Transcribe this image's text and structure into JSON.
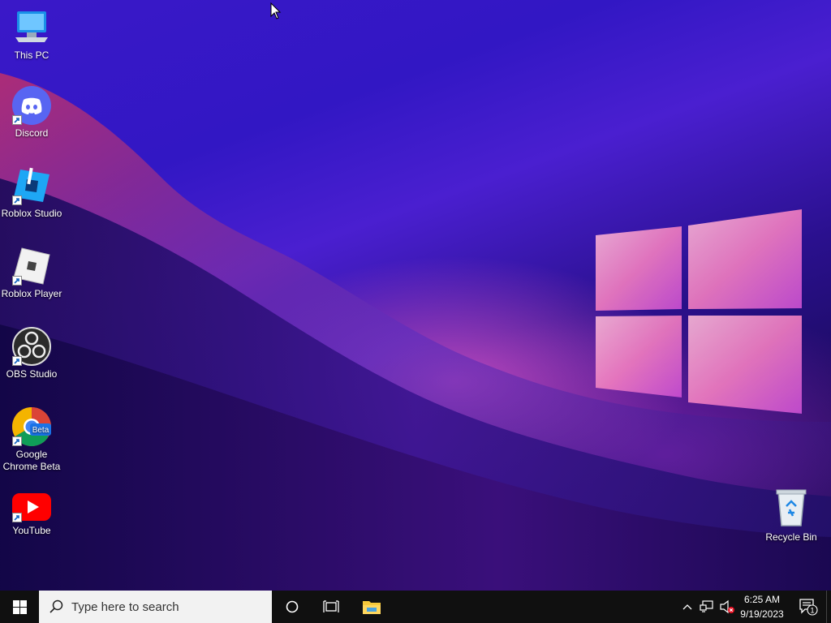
{
  "desktop": {
    "icons": [
      {
        "label": "This PC"
      },
      {
        "label": "Discord"
      },
      {
        "label": "Roblox Studio"
      },
      {
        "label": "Roblox Player"
      },
      {
        "label": "OBS Studio"
      },
      {
        "label": "Google Chrome Beta",
        "badge": "Beta"
      },
      {
        "label": "YouTube"
      },
      {
        "label": "Recycle Bin"
      }
    ]
  },
  "taskbar": {
    "search_placeholder": "Type here to search",
    "clock": {
      "time": "6:25 AM",
      "date": "9/19/2023"
    },
    "notification_count": "1"
  },
  "colors": {
    "taskbar": "#101010",
    "accent_blue": "#0078d7",
    "discord": "#5865f2",
    "youtube": "#ff0000"
  }
}
